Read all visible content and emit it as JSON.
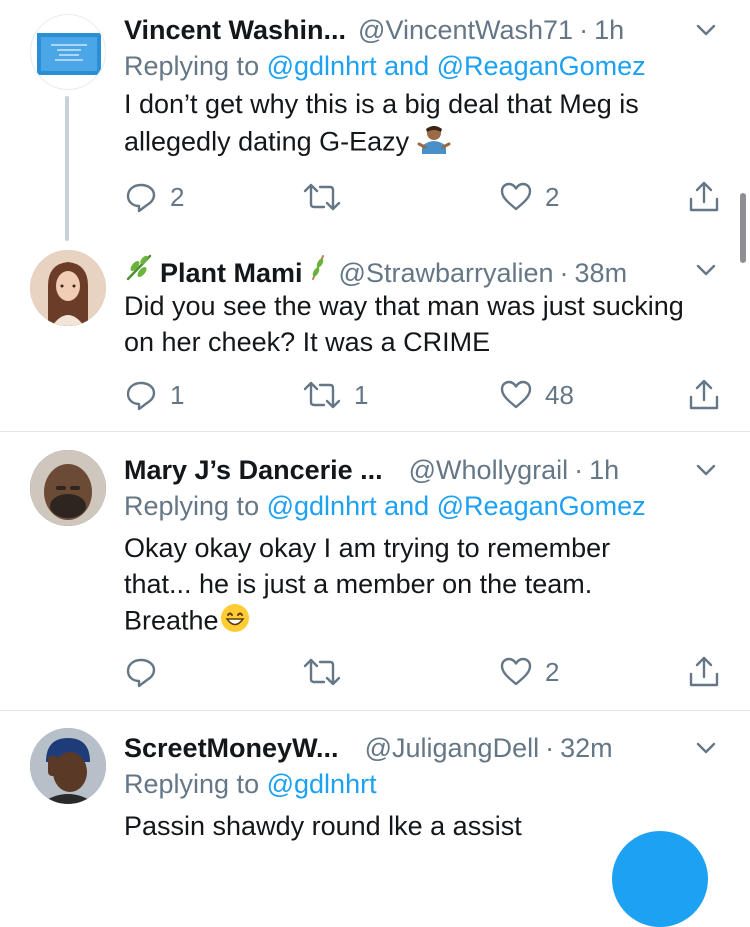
{
  "tweets": [
    {
      "name": "Vincent Washin...",
      "handle": "@VincentWash71",
      "dot": "·",
      "time": "1h",
      "replying_prefix": "Replying to",
      "replying_mentions": "@gdlnhrt and @ReaganGomez",
      "text": "I don’t get why this is a big deal that Meg is allegedly dating G-Eazy",
      "text_emoji": "person-shrugging-emoji",
      "replies": "2",
      "retweets": "",
      "likes": "2"
    },
    {
      "name_prefix_emoji": "herb-emoji",
      "name": "Plant Mami",
      "name_suffix_emoji": "herb-emoji",
      "handle": "@Strawbarryalien",
      "dot": "·",
      "time": "38m",
      "text": "Did you see the way that man was just sucking on her cheek? It was a CRIME",
      "replies": "1",
      "retweets": "1",
      "likes": "48"
    },
    {
      "name": "Mary J’s Dancerie ...",
      "handle": "@Whollygrail",
      "dot": "·",
      "time": "1h",
      "replying_prefix": "Replying to",
      "replying_mentions": "@gdlnhrt and @ReaganGomez",
      "text_line1": "Okay okay okay I am trying to remember",
      "text_line2": "that... he is just a member on the team.",
      "text_line3": "Breathe",
      "text_emoji": "grinning-face-emoji",
      "replies": "",
      "retweets": "",
      "likes": "2"
    },
    {
      "name": "ScreetMoneyW...",
      "handle": "@JuligangDell",
      "dot": "·",
      "time": "32m",
      "replying_prefix": "Replying to",
      "replying_mentions": "@gdlnhrt",
      "text": "Passin shawdy round lke a assist"
    }
  ],
  "colors": {
    "accent": "#1da1f2",
    "secondary_text": "#657786",
    "divider": "#e1e8ed"
  }
}
